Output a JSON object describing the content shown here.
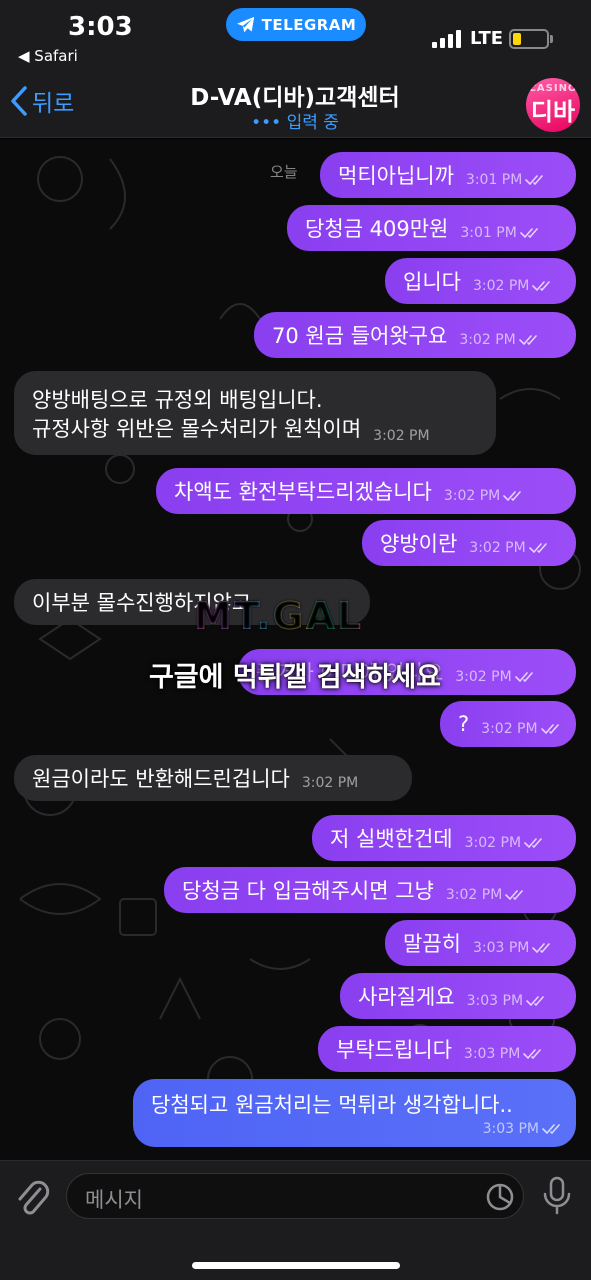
{
  "status_bar": {
    "time": "3:03",
    "back_app": "◀ Safari",
    "pill_label": "TELEGRAM",
    "network": "LTE",
    "battery_color": "#ffd60a"
  },
  "header": {
    "back_label": "뒤로",
    "title": "D-VA(디바)고객센터",
    "status": "••• 입력 중",
    "avatar_small_text": "CASINO",
    "avatar_text": "디바"
  },
  "chat": {
    "date_label": "오늘",
    "messages": [
      {
        "dir": "out",
        "text": "먹티아닙니까",
        "time": "3:01 PM"
      },
      {
        "dir": "out",
        "text": "당청금 409만원",
        "time": "3:01 PM"
      },
      {
        "dir": "out",
        "text": "입니다",
        "time": "3:02 PM"
      },
      {
        "dir": "out",
        "text": "70 원금 들어왓구요",
        "time": "3:02 PM"
      },
      {
        "dir": "in",
        "line1": "양방배팅으로 규정외 배팅입니다.",
        "line2": "규정사항 위반은 몰수처리가 원칙이며",
        "time": "3:02 PM"
      },
      {
        "dir": "out",
        "text": "차액도 환전부탁드리겠습니다",
        "time": "3:02 PM"
      },
      {
        "dir": "out",
        "text": "양방이란",
        "time": "3:02 PM"
      },
      {
        "dir": "in",
        "text": "이부분 몰수진행하지않고",
        "time": ""
      },
      {
        "dir": "out",
        "text": "증거가 어디에 있나요",
        "time": "3:02 PM"
      },
      {
        "dir": "out",
        "text": "?",
        "time": "3:02 PM"
      },
      {
        "dir": "in",
        "text": "원금이라도 반환해드린겁니다",
        "time": "3:02 PM"
      },
      {
        "dir": "out",
        "text": "저 실뱃한건데",
        "time": "3:02 PM"
      },
      {
        "dir": "out",
        "text": "당청금 다 입금해주시면 그냥",
        "time": "3:02 PM"
      },
      {
        "dir": "out",
        "text": "말끔히",
        "time": "3:03 PM"
      },
      {
        "dir": "out",
        "text": "사라질게요",
        "time": "3:03 PM"
      },
      {
        "dir": "out",
        "text": "부탁드립니다",
        "time": "3:03 PM"
      },
      {
        "dir": "out",
        "text": "당첨되고 원금처리는 먹튀라 생각합니다..",
        "time": "3:03 PM"
      }
    ]
  },
  "watermark": {
    "logo": "MT.GAL",
    "caption": "구글에 먹튀갤 검색하세요"
  },
  "composer": {
    "placeholder": "메시지"
  },
  "colors": {
    "outgoing": "#9b4df7",
    "incoming": "#2b2b2e",
    "last_outgoing": "#5a70f8",
    "accent": "#3d9cff"
  }
}
